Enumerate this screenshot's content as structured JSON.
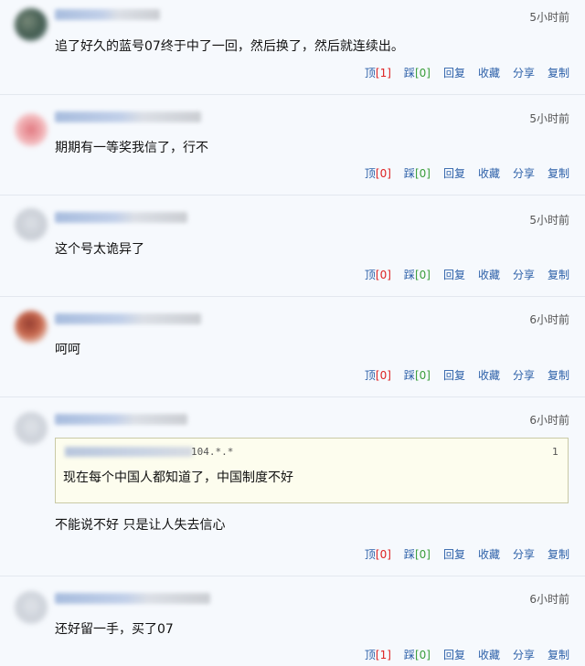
{
  "comments": [
    {
      "time": "5小时前",
      "text": "追了好久的蓝号07终于中了一回，然后换了，然后就连续出。",
      "actions": {
        "up": "顶",
        "up_count": "[1]",
        "down": "踩",
        "down_count": "[0]",
        "reply": "回复",
        "fav": "收藏",
        "share": "分享",
        "copy": "复制"
      }
    },
    {
      "time": "5小时前",
      "text": "期期有一等奖我信了，行不",
      "actions": {
        "up": "顶",
        "up_count": "[0]",
        "down": "踩",
        "down_count": "[0]",
        "reply": "回复",
        "fav": "收藏",
        "share": "分享",
        "copy": "复制"
      }
    },
    {
      "time": "5小时前",
      "text": "这个号太诡异了",
      "actions": {
        "up": "顶",
        "up_count": "[0]",
        "down": "踩",
        "down_count": "[0]",
        "reply": "回复",
        "fav": "收藏",
        "share": "分享",
        "copy": "复制"
      }
    },
    {
      "time": "6小时前",
      "text": "呵呵",
      "actions": {
        "up": "顶",
        "up_count": "[0]",
        "down": "踩",
        "down_count": "[0]",
        "reply": "回复",
        "fav": "收藏",
        "share": "分享",
        "copy": "复制"
      }
    },
    {
      "time": "6小时前",
      "quote": {
        "ip": "104.*.*",
        "floor": "1",
        "text": "现在每个中国人都知道了，中国制度不好"
      },
      "text": "不能说不好  只是让人失去信心",
      "actions": {
        "up": "顶",
        "up_count": "[0]",
        "down": "踩",
        "down_count": "[0]",
        "reply": "回复",
        "fav": "收藏",
        "share": "分享",
        "copy": "复制"
      }
    },
    {
      "time": "6小时前",
      "text": "还好留一手，买了07",
      "actions": {
        "up": "顶",
        "up_count": "[1]",
        "down": "踩",
        "down_count": "[0]",
        "reply": "回复",
        "fav": "收藏",
        "share": "分享",
        "copy": "复制"
      }
    }
  ]
}
